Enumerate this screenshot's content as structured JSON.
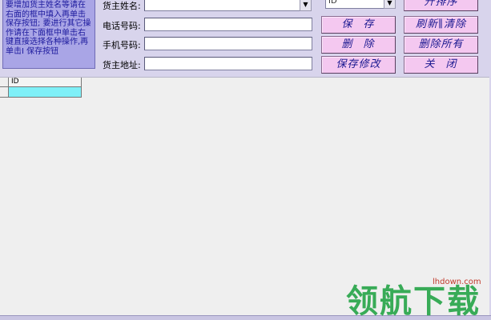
{
  "help_text": "    要增加货主姓名等请在右面的框中填入再单击保存按钮;    要进行其它操作请在下面框中单击右键直接选择各种操作,再单击I  保存按钮",
  "form": {
    "name_label": "货主姓名:",
    "phone_label": "电话号码:",
    "mobile_label": "手机号码:",
    "address_label": "货主地址:",
    "name_value": "",
    "phone_value": "",
    "mobile_value": "",
    "address_value": ""
  },
  "sort": {
    "selected": "ID"
  },
  "buttons": {
    "sort": "升排序",
    "save": "保存",
    "refresh_clear": "刷新∥清除",
    "delete": "删除",
    "delete_all": "删除所有",
    "save_edit": "保存修改",
    "close": "关闭"
  },
  "grid": {
    "columns": [
      "ID"
    ],
    "rows": [
      [
        ""
      ]
    ]
  },
  "watermark": {
    "site": "lhdown.com",
    "text": "领航下载"
  },
  "colors": {
    "background": "#d4d0e8",
    "help_box": "#a9a5e6",
    "button": "#f4c8f0",
    "button_text": "#1a1890",
    "selected_cell": "#7ff0f8",
    "watermark_green": "#2fa84f"
  }
}
